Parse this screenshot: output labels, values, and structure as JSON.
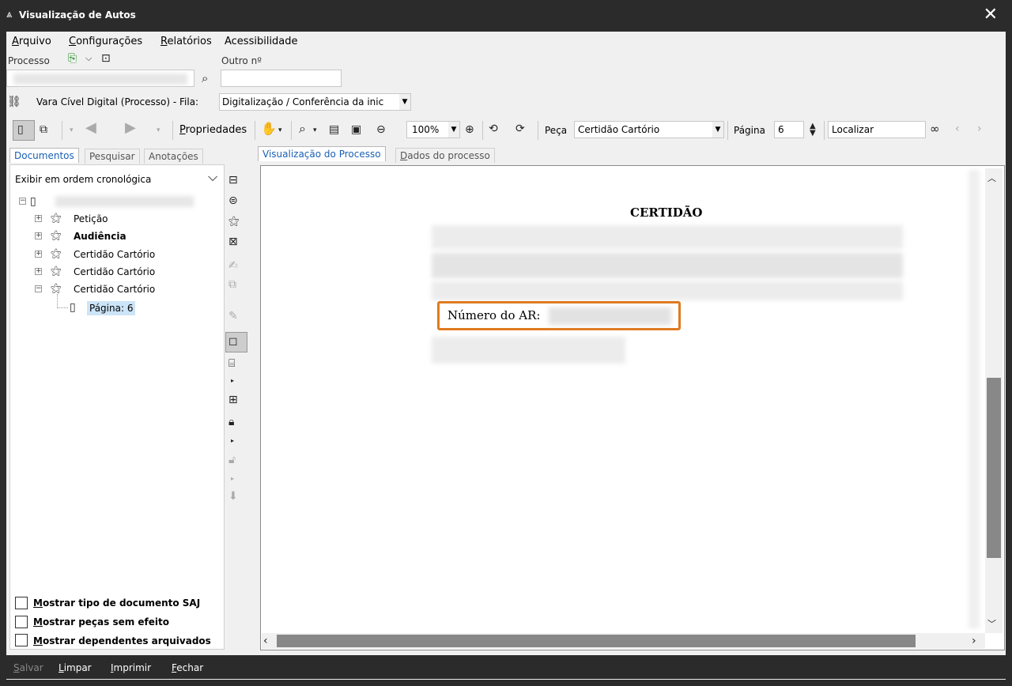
{
  "window": {
    "title": "Visualização de Autos"
  },
  "menu": {
    "arquivo": "Arquivo",
    "configuracoes": "Configurações",
    "relatorios": "Relatórios",
    "acessibilidade": "Acessibilidade"
  },
  "process": {
    "processo_label": "Processo",
    "outro_label": "Outro nº",
    "processo_value": "",
    "outro_value": "",
    "vara_text": "Vara Cível Digital (Processo) - Fila:",
    "fila_value": "Digitalização / Conferência da inic"
  },
  "toolbar": {
    "propriedades": "Propriedades",
    "zoom": "100%",
    "peca_label": "Peça",
    "peca_value": "Certidão Cartório",
    "pagina_label": "Página",
    "pagina_value": "6",
    "localizar_value": "Localizar"
  },
  "left_tabs": [
    "Documentos",
    "Pesquisar",
    "Anotações"
  ],
  "order_select": "Exibir em ordem cronológica",
  "tree": {
    "items": [
      {
        "label": "Petição",
        "bold": false
      },
      {
        "label": "Audiência",
        "bold": true
      },
      {
        "label": "Certidão Cartório",
        "bold": false
      },
      {
        "label": "Certidão Cartório",
        "bold": false
      },
      {
        "label": "Certidão Cartório",
        "bold": false
      }
    ],
    "page_item": "Página: 6"
  },
  "checkboxes": [
    "Mostrar tipo de documento SAJ",
    "Mostrar peças sem efeito",
    "Mostrar dependentes arquivados"
  ],
  "right_tabs": [
    "Visualização do Processo",
    "Dados do processo"
  ],
  "document": {
    "title": "CERTIDÃO",
    "ar_label": "Número do AR:"
  },
  "footer": {
    "salvar": "Salvar",
    "limpar": "Limpar",
    "imprimir": "Imprimir",
    "fechar": "Fechar"
  },
  "colors": {
    "highlight": "#e07a1f",
    "titlebar": "#2b2b2b",
    "accent": "#1a5fb4"
  }
}
